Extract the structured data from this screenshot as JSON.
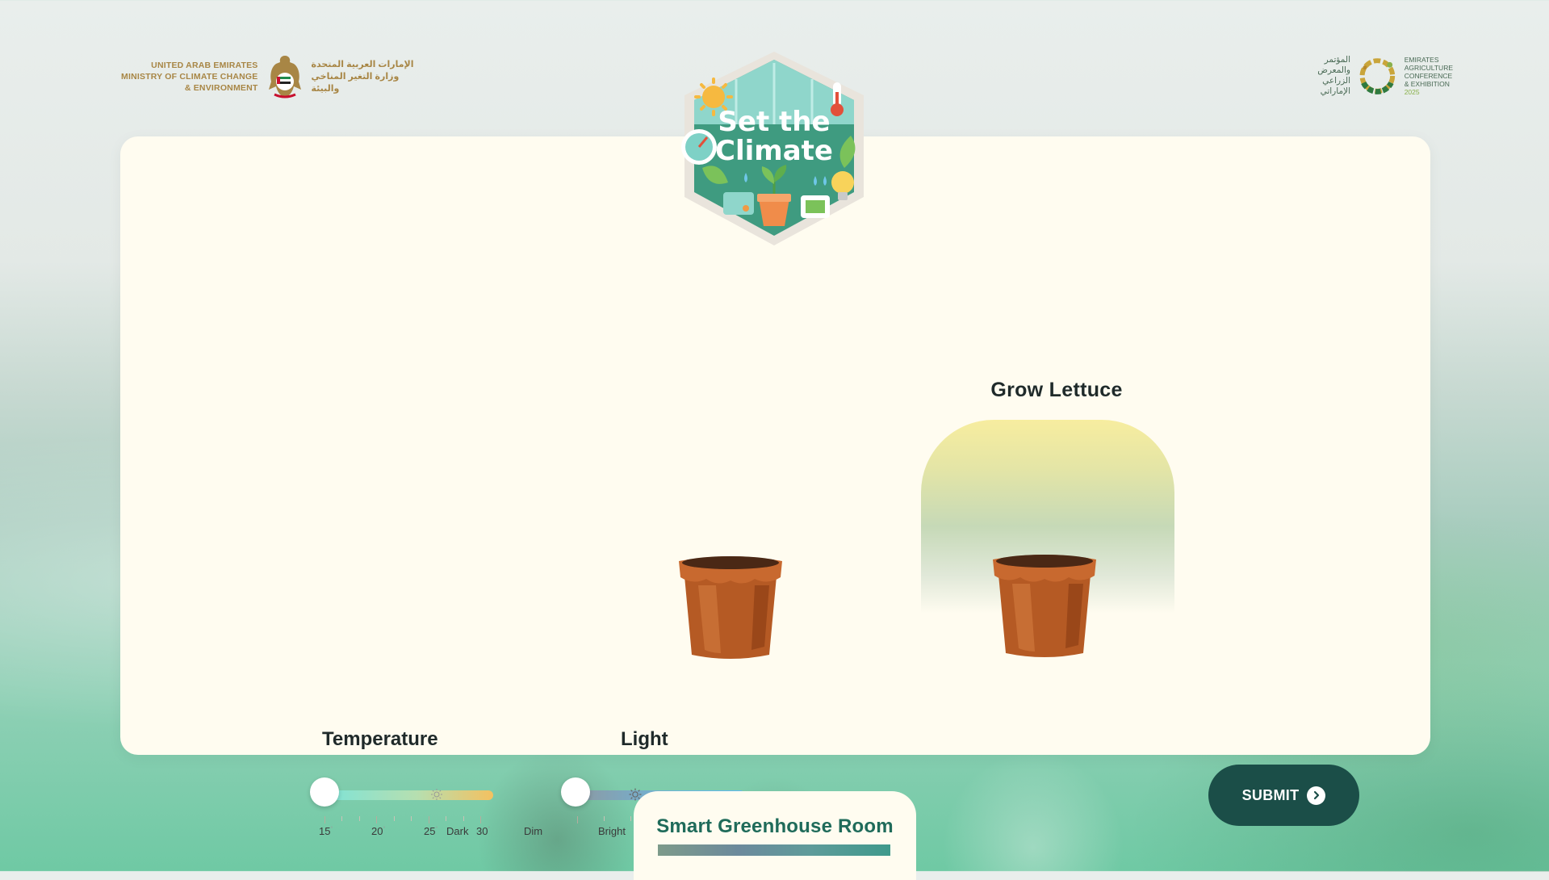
{
  "logos": {
    "left_en_lines": [
      "UNITED ARAB EMIRATES",
      "MINISTRY OF CLIMATE CHANGE",
      "& ENVIRONMENT"
    ],
    "left_ar_lines": [
      "الإمارات العربية المتحدة",
      "وزارة التغير المناخي",
      "والبيئة"
    ],
    "right_ar_lines": [
      "المؤتمر والمعرض",
      "الزراعي الإماراتي"
    ],
    "right_en_lines": [
      "EMIRATES",
      "AGRICULTURE",
      "CONFERENCE",
      "& EXHIBITION"
    ],
    "right_year": "2025"
  },
  "badge": {
    "line1": "Set the",
    "line2": "Climate"
  },
  "goal": {
    "title": "Grow Lettuce"
  },
  "controls": {
    "temperature": {
      "label": "Temperature",
      "scale": [
        "15",
        "20",
        "25",
        "30"
      ],
      "unit": "°",
      "value": 15
    },
    "light": {
      "label": "Light",
      "scale": [
        "Dark",
        "Dim",
        "Bright"
      ],
      "value": "Dark"
    }
  },
  "submit": {
    "label": "SUBMIT"
  },
  "room": {
    "title": "Smart Greenhouse Room"
  },
  "colors": {
    "card_bg": "#fffcf0",
    "submit_bg": "#1b4e48",
    "room_title": "#1f6b5a",
    "logo_gold": "#a88645"
  },
  "icons": {
    "emblem": "uae-falcon-emblem-icon",
    "event_logo": "eace-ring-logo-icon",
    "pot": "clay-pot-icon",
    "sun": "sun-icon",
    "arrow": "arrow-right-circle-icon"
  }
}
